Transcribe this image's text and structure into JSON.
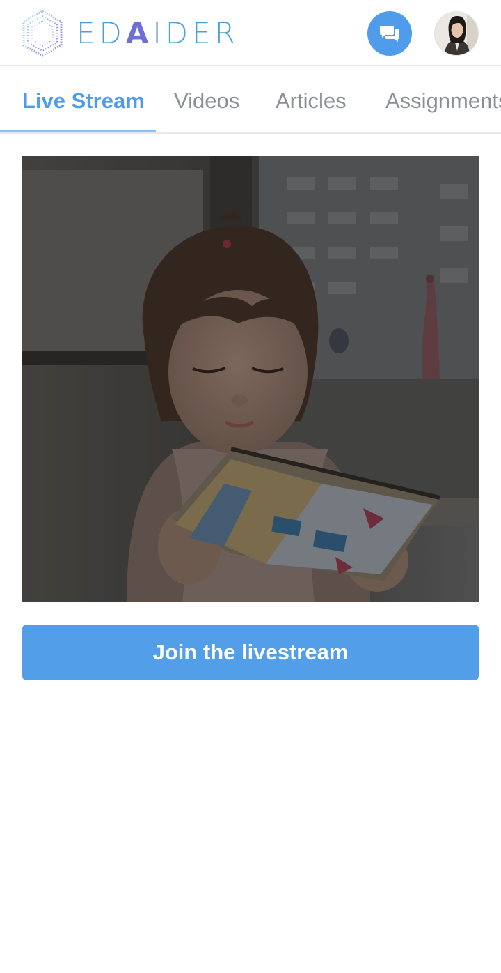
{
  "app": {
    "brand": {
      "parts": [
        "ED",
        "A",
        "I",
        "DER"
      ]
    },
    "colors": {
      "accent": "#4f9dea",
      "button": "#529ee9",
      "tab_inactive": "#8a8f96"
    }
  },
  "header": {
    "chat_icon": "chat-bubbles-icon",
    "avatar_alt": "user-avatar"
  },
  "tabs": [
    {
      "label": "Live Stream",
      "active": true
    },
    {
      "label": "Videos",
      "active": false
    },
    {
      "label": "Articles",
      "active": false
    },
    {
      "label": "Assignments",
      "active": false
    }
  ],
  "main": {
    "hero_image": "girl-reading-book-photo",
    "join_label": "Join the livestream"
  }
}
